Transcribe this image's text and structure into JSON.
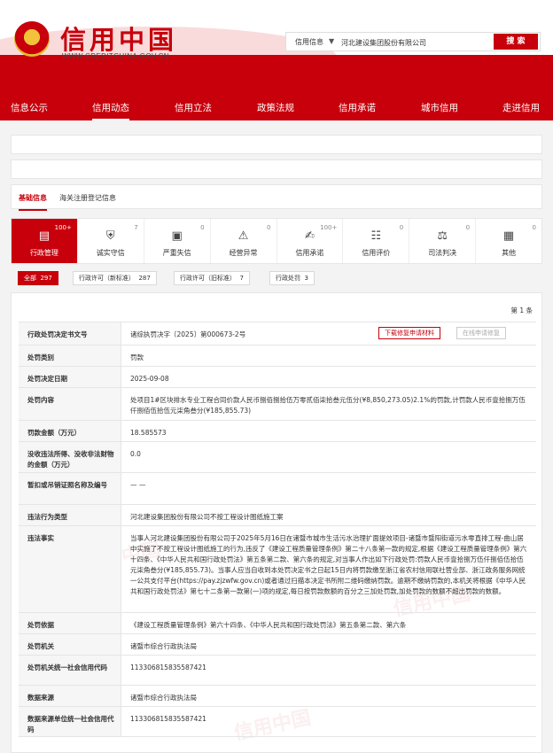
{
  "site": {
    "brand": "信用中国",
    "url": "WWW.CREDITCHINA.GOV.CN"
  },
  "search": {
    "type": "信用信息",
    "caret": "▼",
    "value": "河北建设集团股份有限公司",
    "button": "搜 索"
  },
  "nav": [
    "信息公示",
    "信用动态",
    "信用立法",
    "政策法规",
    "信用承诺",
    "城市信用",
    "走进信用"
  ],
  "tabs": [
    "基础信息",
    "海关注册登记信息"
  ],
  "categories": [
    {
      "label": "行政管理",
      "count": "100+",
      "icon": "admin-doc-icon"
    },
    {
      "label": "诚实守信",
      "count": "7",
      "icon": "shield-icon"
    },
    {
      "label": "严重失信",
      "count": "0",
      "icon": "id-card-icon"
    },
    {
      "label": "经营异常",
      "count": "0",
      "icon": "alarm-icon"
    },
    {
      "label": "信用承诺",
      "count": "100+",
      "icon": "promise-icon"
    },
    {
      "label": "信用评价",
      "count": "0",
      "icon": "evaluation-icon"
    },
    {
      "label": "司法判决",
      "count": "0",
      "icon": "judgment-icon"
    },
    {
      "label": "其他",
      "count": "0",
      "icon": "other-icon"
    }
  ],
  "filters": [
    {
      "label": "全部",
      "count": "297"
    },
    {
      "label": "行政许可（新标准）",
      "count": "287"
    },
    {
      "label": "行政许可（旧标准）",
      "count": "7"
    },
    {
      "label": "行政处罚",
      "count": "3"
    }
  ],
  "record": {
    "page_label": "第 1 条",
    "download_button": "下载修复申请材料",
    "online_button": "在线申请修复",
    "watermark": "信用中国",
    "fields": [
      {
        "key": "行政处罚决定书文号",
        "value": "诸综执罚决字〔2025〕第000673-2号"
      },
      {
        "key": "处罚类别",
        "value": "罚款"
      },
      {
        "key": "处罚决定日期",
        "value": "2025-09-08"
      },
      {
        "key": "处罚内容",
        "value": "处项目1#区块排水专业工程合同价款人民币捌佰捌拾伍万零贰佰柒拾叁元伍分(¥8,850,273.05)2.1%的罚款,计罚款人民币壹拾捌万伍仟捌佰伍拾伍元柒角叁分(¥185,855.73)"
      },
      {
        "key": "罚款金额（万元）",
        "value": "18.585573"
      },
      {
        "key": "没收违法所得、没收非法财物的金额（万元）",
        "value": "0.0"
      },
      {
        "key": "暂扣或吊销证照名称及编号",
        "value": "— —"
      },
      {
        "key": "违法行为类型",
        "value": "河北建设集团股份有限公司不按工程设计图纸施工案"
      },
      {
        "key": "违法事实",
        "value": "当事人河北建设集团股份有限公司于2025年5月16日在诸暨市城市生活污水治理扩面提效项目-诸暨市暨阳街道污水零直排工程-曲山居中实施了不按工程设计图纸施工的行为,违反了《建设工程质量管理条例》第二十八条第一款的规定,根据《建设工程质量管理条例》第六十四条、《中华人民共和国行政处罚法》第五条第二款、第六条的规定,对当事人作出如下行政处罚:罚款人民币壹拾捌万伍仟捌佰伍拾伍元柒角叁分(¥185,855.73)。当事人应当自收到本处罚决定书之日起15日内将罚款缴至浙江省农村信用联社营业部、浙江政务服务网统一公共支付平台(https://pay.zjzwfw.gov.cn)或者通过扫描本决定书所附二维码缴纳罚款。逾期不缴纳罚款的,本机关将根据《中华人民共和国行政处罚法》第七十二条第一款第(一)项的规定,每日按罚款数额的百分之三加处罚款,加处罚款的数额不超出罚款的数额。"
      },
      {
        "key": "处罚依据",
        "value": "《建设工程质量管理条例》第六十四条、《中华人民共和国行政处罚法》第五条第二款、第六条"
      },
      {
        "key": "处罚机关",
        "value": "诸暨市综合行政执法局"
      },
      {
        "key": "处罚机关统一社会信用代码",
        "value": "113306815835587421"
      },
      {
        "key": "数据来源",
        "value": "诸暨市综合行政执法局"
      },
      {
        "key": "数据来源单位统一社会信用代码",
        "value": "113306815835587421"
      }
    ]
  }
}
